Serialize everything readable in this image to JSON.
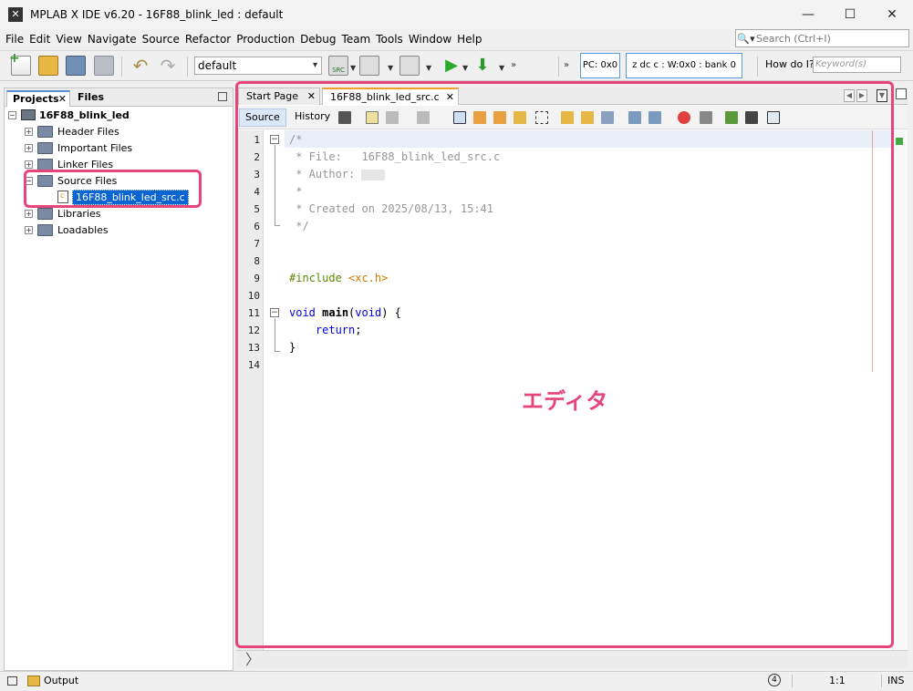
{
  "window": {
    "title": "MPLAB X IDE v6.20 - 16F88_blink_led : default",
    "app_icon": "mplab-logo-icon",
    "controls": [
      "minimize-icon",
      "maximize-icon",
      "close-icon"
    ]
  },
  "menu": [
    "File",
    "Edit",
    "View",
    "Navigate",
    "Source",
    "Refactor",
    "Production",
    "Debug",
    "Team",
    "Tools",
    "Window",
    "Help"
  ],
  "search": {
    "placeholder": "Search (Ctrl+I)"
  },
  "toolbar": {
    "configuration": "default",
    "pc_status": "PC: 0x0",
    "register_status": "z dc c  : W:0x0 : bank 0",
    "howdo_label": "How do I?",
    "keyword_placeholder": "Keyword(s)"
  },
  "projects_panel": {
    "tabs": [
      "Projects",
      "Files"
    ],
    "tree": [
      {
        "label": "16F88_blink_led",
        "type": "project",
        "expanded": true
      },
      {
        "label": "Header Files",
        "type": "folder"
      },
      {
        "label": "Important Files",
        "type": "folder"
      },
      {
        "label": "Linker Files",
        "type": "folder"
      },
      {
        "label": "Source Files",
        "type": "folder",
        "expanded": true
      },
      {
        "label": "16F88_blink_led_src.c",
        "type": "file",
        "selected": true
      },
      {
        "label": "Libraries",
        "type": "folder"
      },
      {
        "label": "Loadables",
        "type": "folder"
      }
    ]
  },
  "editor": {
    "tabs": [
      "Start Page",
      "16F88_blink_led_src.c"
    ],
    "source_label": "Source",
    "history_label": "History",
    "lines": [
      "1",
      "2",
      "3",
      "4",
      "5",
      "6",
      "7",
      "8",
      "9",
      "10",
      "11",
      "12",
      "13",
      "14"
    ],
    "code": {
      "l1": "/*",
      "l2": " * File:   16F88_blink_led_src.c",
      "l3": " * Author: ",
      "l4": " *",
      "l5": " * Created on 2025/08/13, 15:41",
      "l6": " */",
      "l9_directive": "#include",
      "l9_header": "<xc.h>",
      "l11_void": "void",
      "l11_main": "main",
      "l11_open": "(",
      "l11_void2": "void",
      "l11_close": ") {",
      "l12_return": "return",
      "l12_semi": ";",
      "l13": "}"
    },
    "annotation_label": "エディタ"
  },
  "status": {
    "output_label": "Output",
    "notifications": "4",
    "position": "1:1",
    "mode": "INS"
  },
  "colors": {
    "annotation": "#e6447a",
    "selection": "#0a64d2",
    "keyword": "#0000e6",
    "comment": "#969696"
  }
}
